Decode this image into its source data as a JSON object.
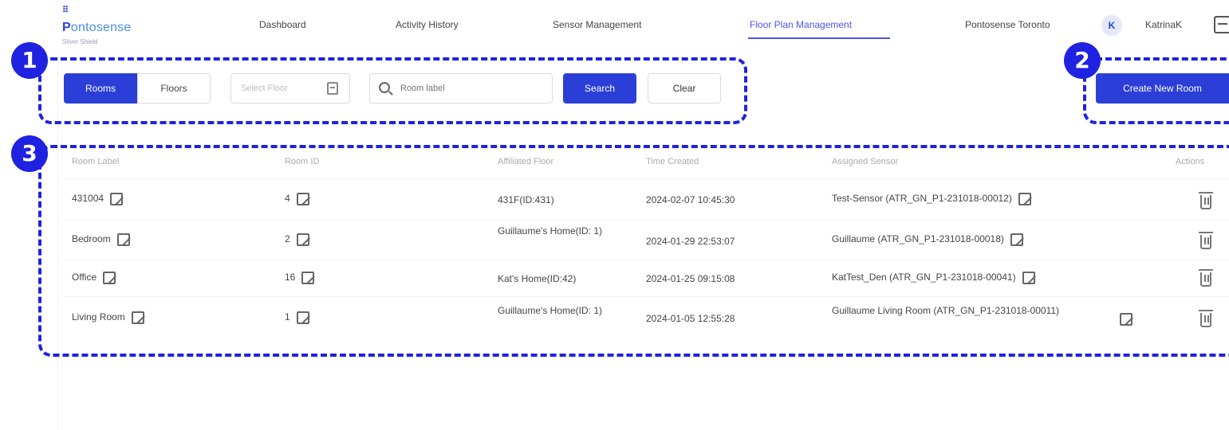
{
  "nav": {
    "logo_mark": "⠿",
    "logo_first": "P",
    "logo_rest": "ontosense",
    "logo_sub": "Silver Shield",
    "links": [
      "Dashboard",
      "Activity History",
      "Sensor Management",
      "Floor Plan Management"
    ],
    "org": "Pontosense Toronto",
    "avatar_letter": "K",
    "username": "KatrinaK"
  },
  "toolbar": {
    "tab_rooms": "Rooms",
    "tab_floors": "Floors",
    "floor_placeholder": "Select Floor",
    "search_placeholder": "Room label",
    "search_label": "Search",
    "clear_label": "Clear",
    "create_label": "Create New Room"
  },
  "table": {
    "headers": [
      "Room Label",
      "Room ID",
      "Affiliated Floor",
      "Time Created",
      "Assigned Sensor",
      "Actions"
    ],
    "rows": [
      {
        "label": "431004",
        "id": "4",
        "floor": "431F(ID:431)",
        "time": "2024-02-07 10:45:30",
        "sensor": "Test-Sensor (ATR_GN_P1-231018-00012)"
      },
      {
        "label": "Bedroom",
        "id": "2",
        "floor": "Guillaume's Home(ID: 1)",
        "time": "2024-01-29 22:53:07",
        "sensor": "Guillaume (ATR_GN_P1-231018-00018)"
      },
      {
        "label": "Office",
        "id": "16",
        "floor": "Kat's Home(ID:42)",
        "time": "2024-01-25 09:15:08",
        "sensor": "KatTest_Den (ATR_GN_P1-231018-00041)"
      },
      {
        "label": "Living Room",
        "id": "1",
        "floor": "Guillaume's Home(ID: 1)",
        "time": "2024-01-05 12:55:28",
        "sensor": "Guillaume Living Room (ATR_GN_P1-231018-00011)"
      }
    ]
  },
  "annotations": {
    "one": "1",
    "two": "2",
    "three": "3",
    "color": "#1f22e0"
  }
}
